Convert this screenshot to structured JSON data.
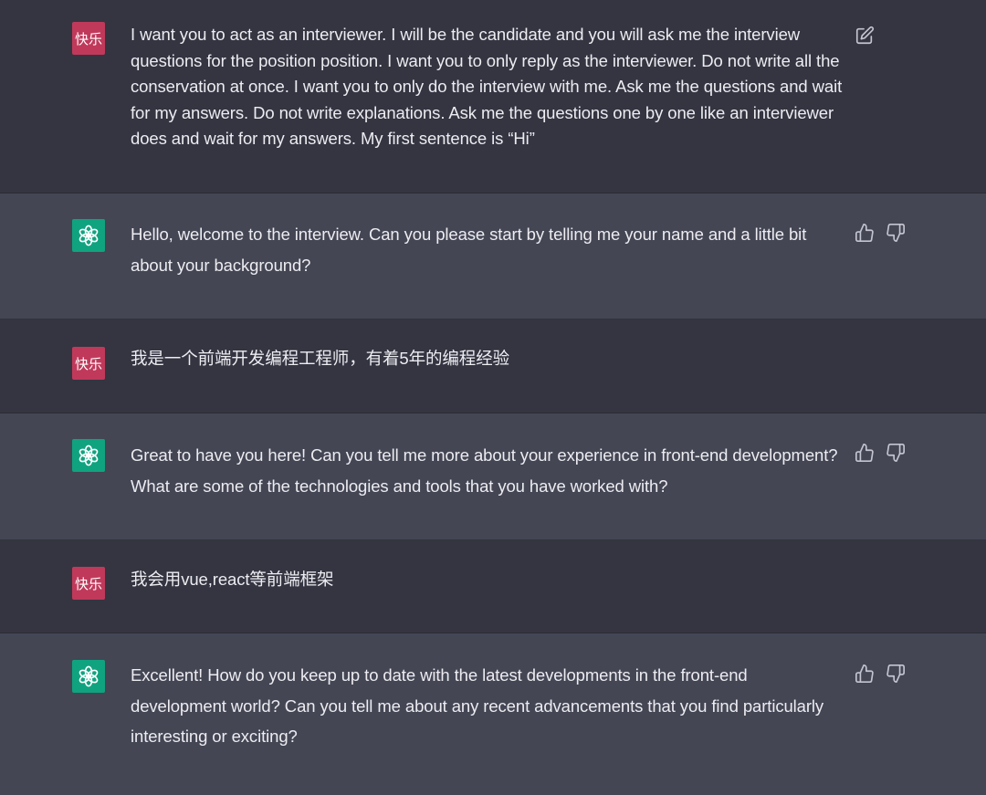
{
  "conversation": [
    {
      "role": "user",
      "avatar_text": "快乐",
      "text": "I want you to act as an interviewer. I will be the candidate and you will ask me the interview questions for the position position. I want you to only reply as the interviewer. Do not write all the conservation at once. I want you to only do the interview with me. Ask me the questions and wait for my answers. Do not write explanations. Ask me the questions one by one like an interviewer does and wait for my answers. My first sentence is “Hi”",
      "action_icon": "edit-icon"
    },
    {
      "role": "assistant",
      "avatar_icon": "chatgpt-logo-icon",
      "text": "Hello, welcome to the interview. Can you please start by telling me your name and a little bit about your background?",
      "action_icons": [
        "thumbs-up-icon",
        "thumbs-down-icon"
      ]
    },
    {
      "role": "user",
      "avatar_text": "快乐",
      "text": "我是一个前端开发编程工程师，有着5年的编程经验"
    },
    {
      "role": "assistant",
      "avatar_icon": "chatgpt-logo-icon",
      "text": "Great to have you here! Can you tell me more about your experience in front-end development? What are some of the technologies and tools that you have worked with?",
      "action_icons": [
        "thumbs-up-icon",
        "thumbs-down-icon"
      ]
    },
    {
      "role": "user",
      "avatar_text": "快乐",
      "text": "我会用vue,react等前端框架"
    },
    {
      "role": "assistant",
      "avatar_icon": "chatgpt-logo-icon",
      "text": "Excellent! How do you keep up to date with the latest developments in the front-end development world? Can you tell me about any recent advancements that you find particularly interesting or exciting?",
      "action_icons": [
        "thumbs-up-icon",
        "thumbs-down-icon"
      ]
    }
  ],
  "colors": {
    "user_background": "#343541",
    "assistant_background": "#444654",
    "user_avatar": "#c0395b",
    "bot_avatar": "#10a37f",
    "text": "#ececf1",
    "icon": "#c5c5d2"
  }
}
